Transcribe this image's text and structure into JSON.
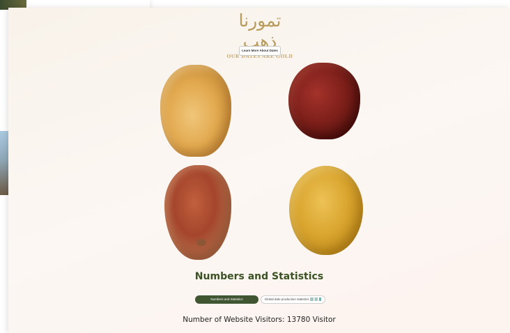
{
  "logo": {
    "arabic": "تمورنا ذهب",
    "tagline": "OUR DATES ARE GOLD"
  },
  "buttons": {
    "learn_more": "Learn More About Dates"
  },
  "dates": [
    {
      "name": "light-golden-date",
      "color": "#e2a94f"
    },
    {
      "name": "dark-red-date",
      "color": "#7e1f1a"
    },
    {
      "name": "reddish-brown-date",
      "color": "#a5452c"
    },
    {
      "name": "yellow-date",
      "color": "#d9a52e"
    }
  ],
  "section": {
    "title": "Numbers and Statistics"
  },
  "tabs": [
    {
      "label": "Numbers and Statistics",
      "active": true
    },
    {
      "label": "Global date production statistics",
      "active": false
    }
  ],
  "visitors": {
    "text": "Number of Website Visitors: 13780 Visitor"
  },
  "colors": {
    "accent": "#405531",
    "title": "#3a5223",
    "gold": "#b89a5a"
  }
}
